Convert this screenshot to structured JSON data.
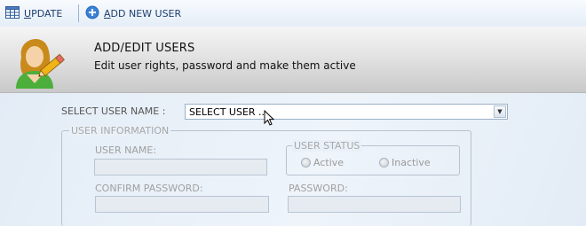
{
  "toolbar": {
    "update_label_first": "U",
    "update_label_rest": "PDATE",
    "add_label_first": "A",
    "add_label_rest": "DD NEW USER"
  },
  "header": {
    "title": "ADD/EDIT USERS",
    "subtitle": "Edit user rights, password and  make them active"
  },
  "select_user": {
    "label": "SELECT USER NAME :",
    "value": "SELECT USER ..."
  },
  "user_information": {
    "title": "USER INFORMATION",
    "user_name_label": "USER NAME:",
    "confirm_password_label": "CONFIRM PASSWORD:",
    "password_label": "PASSWORD:",
    "user_name_value": "",
    "confirm_password_value": "",
    "password_value": ""
  },
  "user_status": {
    "title": "USER STATUS",
    "options": [
      "Active",
      "Inactive"
    ]
  },
  "icons": {
    "update": "grid-table-icon",
    "add_user": "plus-circle-icon",
    "header": "user-pencil-icon",
    "cursor": "mouse-pointer-icon"
  },
  "colors": {
    "accent": "#1d3f6e",
    "add_icon": "#2f6fc1",
    "background": "#eaf1f9"
  }
}
